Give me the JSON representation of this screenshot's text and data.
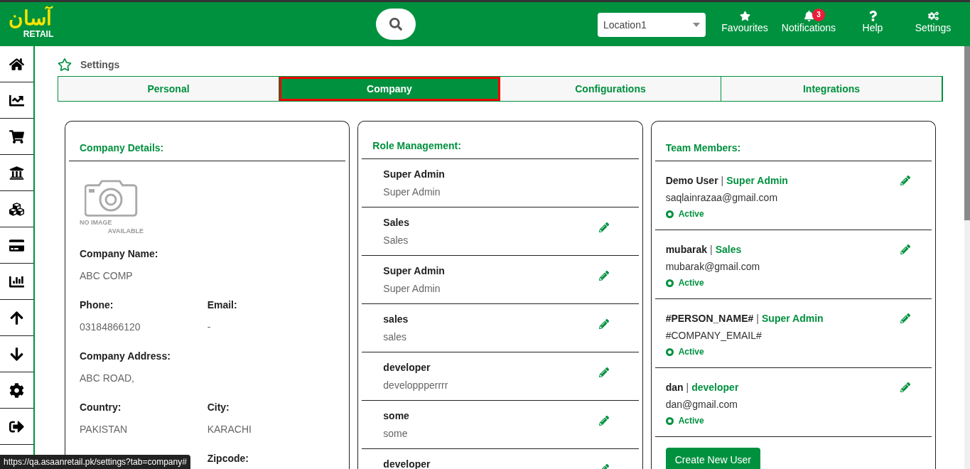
{
  "logo": {
    "script": "آسان",
    "word": "RETAIL"
  },
  "location": {
    "value": "Location1"
  },
  "nav": [
    {
      "label": "Favourites"
    },
    {
      "label": "Notifications",
      "badge": "3"
    },
    {
      "label": "Help"
    },
    {
      "label": "Settings"
    }
  ],
  "breadcrumb": "Settings",
  "tabs": [
    {
      "label": "Personal",
      "selected": false
    },
    {
      "label": "Company",
      "selected": true
    },
    {
      "label": "Configurations",
      "selected": false
    },
    {
      "label": "Integrations",
      "selected": false
    }
  ],
  "company": {
    "title": "Company Details:",
    "image_text": [
      "NO IMAGE",
      "AVAILABLE"
    ],
    "fields": [
      [
        {
          "label": "Company Name:",
          "value": "ABC COMP"
        }
      ],
      [
        {
          "label": "Phone:",
          "value": "03184866120"
        },
        {
          "label": "Email:",
          "value": "-"
        }
      ],
      [
        {
          "label": "Company Address:",
          "value": "ABC ROAD,"
        }
      ],
      [
        {
          "label": "Country:",
          "value": "PAKISTAN"
        },
        {
          "label": "City:",
          "value": "KARACHI"
        }
      ],
      [
        {
          "label": "Zipcode:"
        }
      ]
    ]
  },
  "roles": {
    "title": "Role Management:",
    "items": [
      {
        "name": "Super Admin",
        "description": "Super Admin",
        "editable": false
      },
      {
        "name": "Sales",
        "description": "Sales",
        "editable": true
      },
      {
        "name": "Super Admin",
        "description": "Super Admin",
        "editable": true
      },
      {
        "name": "sales",
        "description": "sales",
        "editable": true
      },
      {
        "name": "developer",
        "description": "developpperrrr",
        "editable": true
      },
      {
        "name": "some",
        "description": "some",
        "editable": true
      },
      {
        "name": "developer",
        "editable": true
      }
    ]
  },
  "team": {
    "title": "Team Members:",
    "members": [
      {
        "name": "Demo User",
        "separator": "|",
        "role": "Super Admin",
        "email": "saqlainrazaa@gmail.com",
        "status": "Active",
        "color": "#00913f"
      },
      {
        "name": "mubarak",
        "separator": "|",
        "role": "Sales",
        "email": "mubarak@gmail.com",
        "status": "Active",
        "color": "#00913f"
      },
      {
        "name": "#PERSON_NAME#",
        "separator": "|",
        "role": "Super Admin",
        "email": "#COMPANY_EMAIL#",
        "status": "Active",
        "color": "#00913f"
      },
      {
        "name": "dan",
        "separator": "|",
        "role": "developer",
        "email": "dan@gmail.com",
        "status": "Active",
        "color": "#00913f"
      }
    ],
    "button": "Create New User"
  },
  "status_url": "https://qa.asaanretail.pk/settings?tab=company#"
}
